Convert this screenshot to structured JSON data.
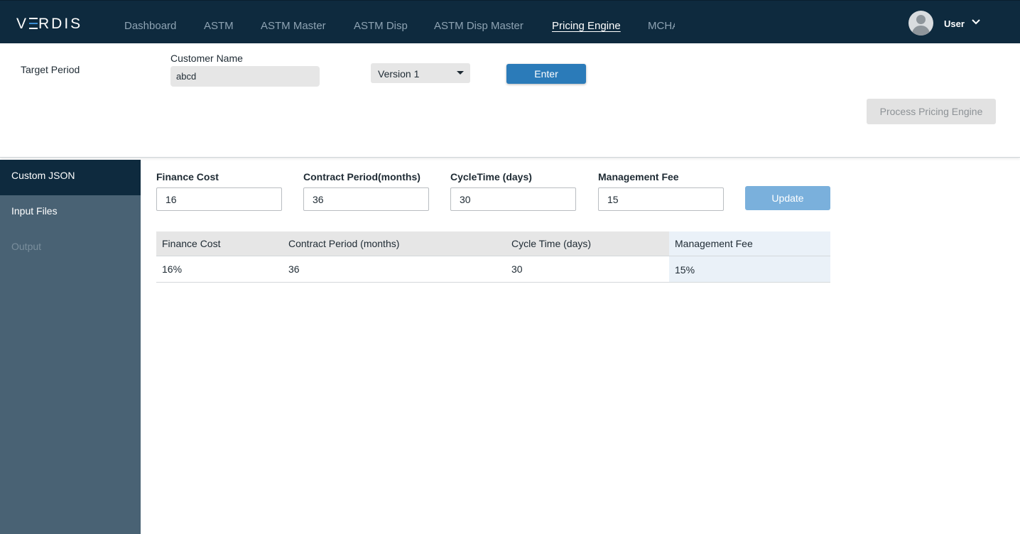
{
  "app": {
    "logo": "VERDIS"
  },
  "nav": {
    "items": [
      {
        "label": "Dashboard"
      },
      {
        "label": "ASTM"
      },
      {
        "label": "ASTM Master"
      },
      {
        "label": "ASTM Disp"
      },
      {
        "label": "ASTM Disp Master"
      },
      {
        "label": "Pricing Engine",
        "active": true
      },
      {
        "label": "MCHA"
      }
    ]
  },
  "user": {
    "name": "User",
    "avatar_icon": "user-avatar-icon",
    "menu_icon": "chevron-down-icon"
  },
  "form": {
    "target_period_label": "Target Period",
    "customer_name_label": "Customer Name",
    "customer_name_value": "abcd",
    "version_value": "Version 1",
    "enter_label": "Enter",
    "process_label": "Process Pricing Engine"
  },
  "sidebar": {
    "items": [
      {
        "label": "Custom JSON",
        "state": "active"
      },
      {
        "label": "Input Files",
        "state": "normal"
      },
      {
        "label": "Output",
        "state": "disabled"
      }
    ]
  },
  "params": {
    "finance_cost_label": "Finance Cost",
    "finance_cost_value": "16",
    "contract_period_label": "Contract Period(months)",
    "contract_period_value": "36",
    "cycle_time_label": "CycleTime (days)",
    "cycle_time_value": "30",
    "management_fee_label": "Management Fee",
    "management_fee_value": "15",
    "update_label": "Update"
  },
  "table": {
    "headers": [
      "Finance Cost",
      "Contract Period (months)",
      "Cycle Time (days)",
      "Management Fee"
    ],
    "rows": [
      [
        "16%",
        "36",
        "30",
        "15%"
      ]
    ]
  },
  "colors": {
    "nav_bg": "#0e2a3e",
    "sidebar_bg": "#496274",
    "primary_button": "#2b7bb9",
    "update_button": "#7ab0dc"
  }
}
